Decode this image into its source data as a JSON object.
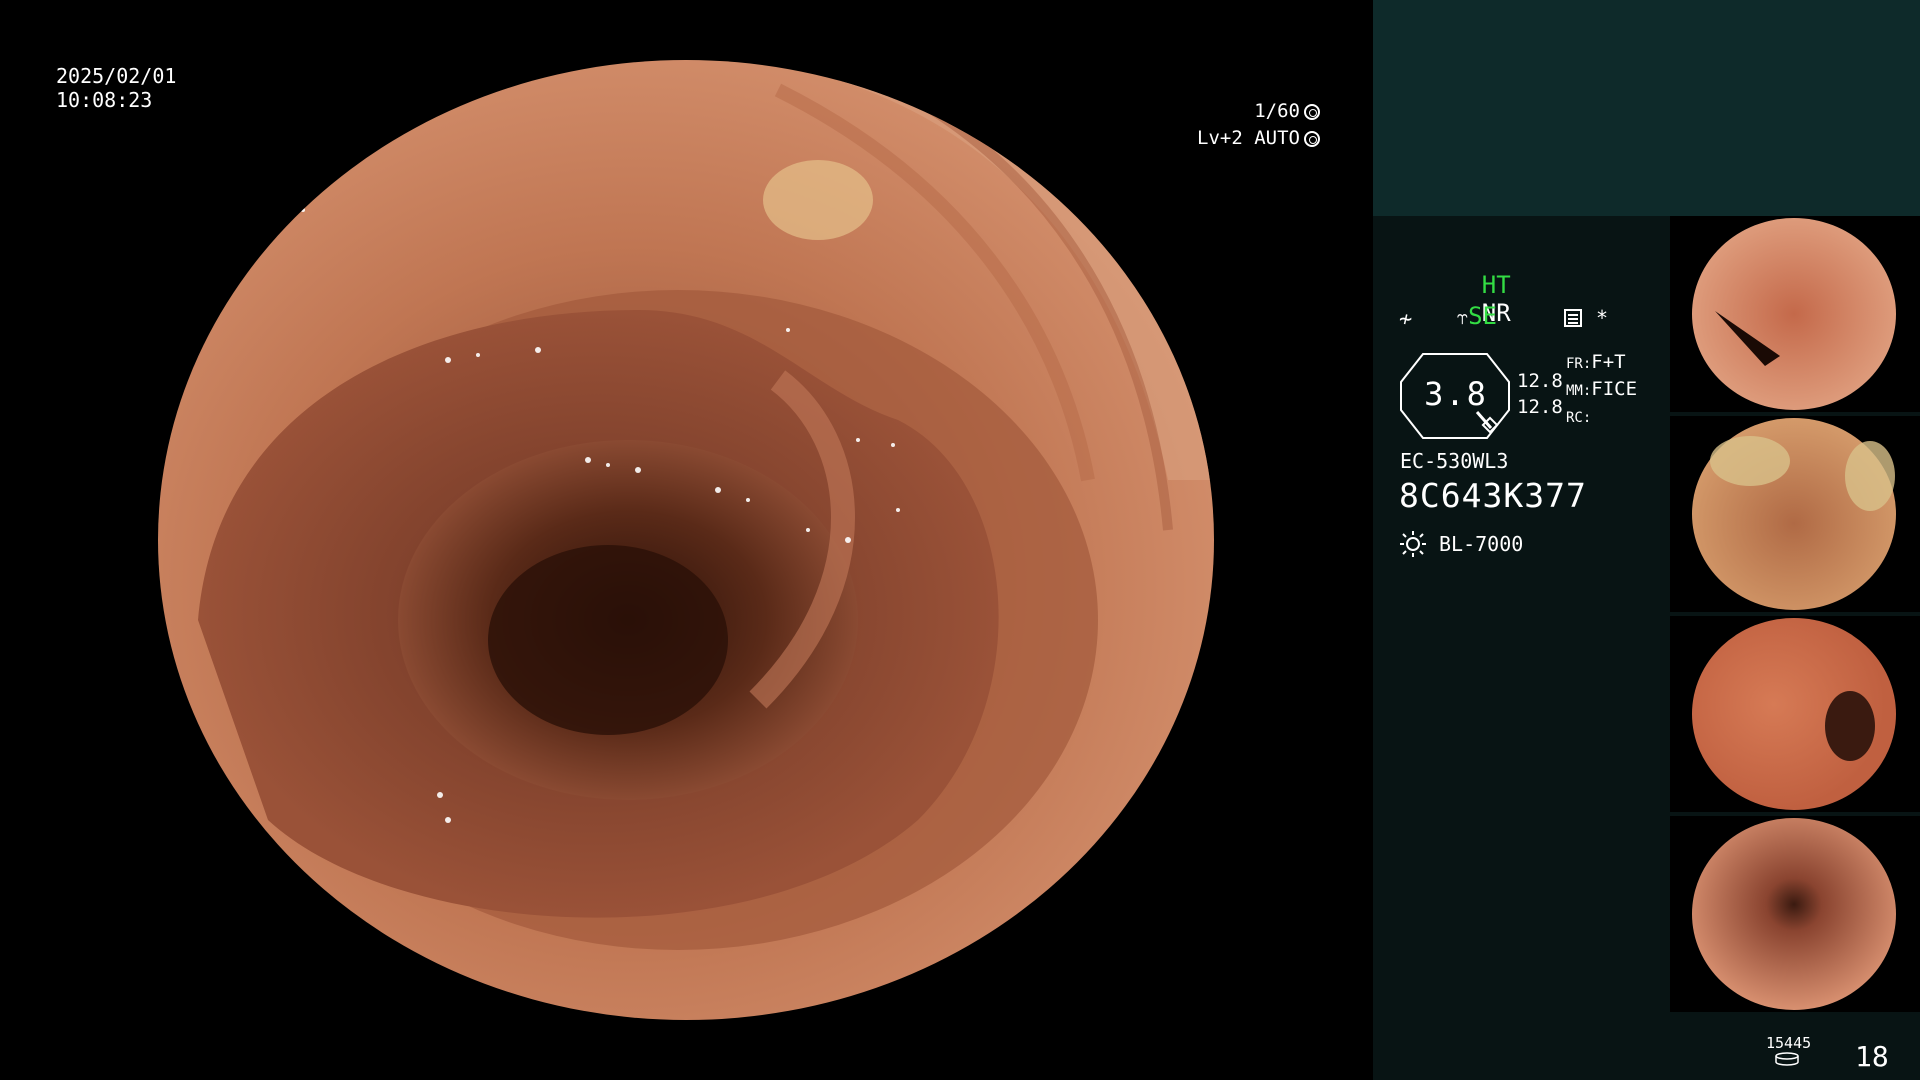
{
  "overlay": {
    "date": "2025/02/01",
    "time": "10:08:23",
    "shutter": "1/60",
    "iris_mode": "Lv+2 AUTO"
  },
  "status": {
    "ht": "HT",
    "nr": "NR",
    "se": "SE",
    "asterisk": "*"
  },
  "zoom": {
    "value": "3.8",
    "num1": "12.8",
    "num2": "12.8"
  },
  "processing": {
    "fr_label": "FR:",
    "fr_value": "F+T",
    "mm_label": "MM:",
    "mm_value": "FICE",
    "rc_label": "RC:"
  },
  "scope": {
    "model": "EC-530WL3",
    "serial": "8C643K377",
    "light_source": "BL-7000"
  },
  "counters": {
    "storage": "15445",
    "image_count": "18"
  },
  "colors": {
    "ht_accent": "#33dd44",
    "panel_bg": "#081414",
    "panel_top": "#0e2a2a"
  },
  "icons": {
    "shutter": "aperture-icon",
    "iris": "iris-ring-icon",
    "scope_bend": "scope-bend-icon",
    "curve": "curve-icon",
    "menu": "menu-list-icon",
    "light": "sun-icon",
    "storage": "disk-icon",
    "zoom": "magnifier-icon"
  }
}
